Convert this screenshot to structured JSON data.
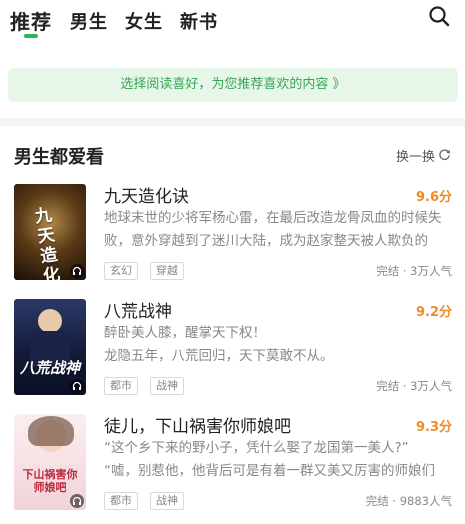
{
  "tabs": [
    {
      "label": "推荐"
    },
    {
      "label": "男生"
    },
    {
      "label": "女生"
    },
    {
      "label": "新书"
    }
  ],
  "icons": {
    "search": "search-icon",
    "refresh": "refresh-icon",
    "audio": "headphones-icon"
  },
  "banner": {
    "text": "选择阅读喜好，为您推荐喜欢的内容 》"
  },
  "section": {
    "title": "男生都爱看",
    "refresh_label": "换一换"
  },
  "books": [
    {
      "title": "九天造化诀",
      "score": "9.6分",
      "desc": "地球末世的少将军杨心雷，在最后改造龙骨凤血的时候失败，意外穿越到了迷川大陆，成为赵家整天被人欺负的",
      "tags": [
        "玄幻",
        "穿越"
      ],
      "status": "完结 · 3万人气",
      "cover_text": "九天造化诀"
    },
    {
      "title": "八荒战神",
      "score": "9.2分",
      "desc": "醉卧美人膝，醒掌天下权！\n龙隐五年，八荒回归，天下莫敢不从。",
      "tags": [
        "都市",
        "战神"
      ],
      "status": "完结 · 3万人气",
      "cover_text": "八荒战神"
    },
    {
      "title": "徒儿，下山祸害你师娘吧",
      "score": "9.3分",
      "desc": "“这个乡下来的野小子，凭什么娶了龙国第一美人?”\n“嘘，别惹他，他背后可是有着一群又美又厉害的师娘们",
      "tags": [
        "都市",
        "战神"
      ],
      "status": "完结 · 9883人气",
      "cover_text": "下山祸害你师娘吧"
    }
  ],
  "colors": {
    "accent": "#2db84c",
    "score": "#f08a24",
    "banner_bg": "#e6f7ea"
  }
}
